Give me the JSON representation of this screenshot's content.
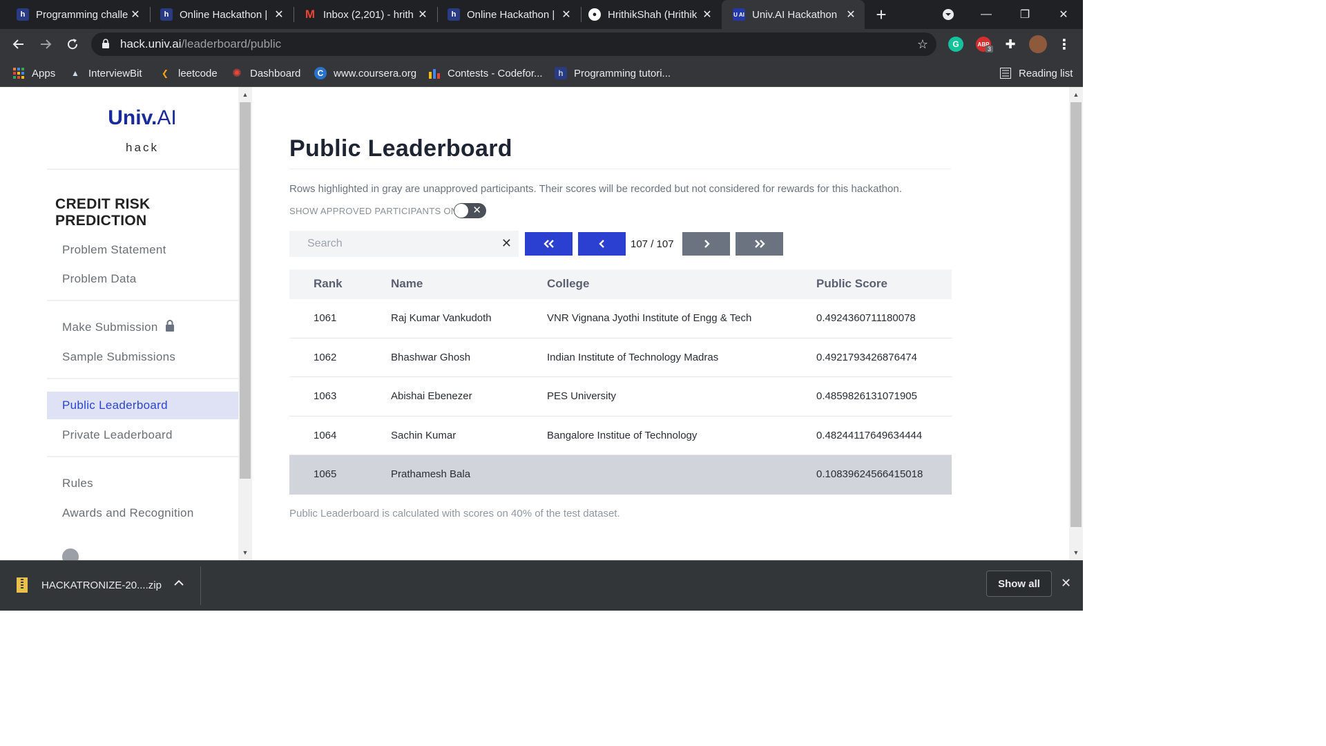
{
  "browser": {
    "tabs": [
      {
        "title": "Programming challe",
        "favicon": "h"
      },
      {
        "title": "Online Hackathon |",
        "favicon": "h"
      },
      {
        "title": "Inbox (2,201) - hrith",
        "favicon": "M"
      },
      {
        "title": "Online Hackathon |",
        "favicon": "h"
      },
      {
        "title": "HrithikShah (Hrithik",
        "favicon": "github"
      },
      {
        "title": "Univ.AI Hackathon",
        "favicon": "AI",
        "active": true
      }
    ],
    "url_host": "hack.univ.ai",
    "url_path": "/leaderboard/public",
    "extension_badge": "3",
    "bookmarks": [
      {
        "label": "Apps"
      },
      {
        "label": "InterviewBit"
      },
      {
        "label": "leetcode"
      },
      {
        "label": "Dashboard"
      },
      {
        "label": "www.coursera.org"
      },
      {
        "label": "Contests - Codefor..."
      },
      {
        "label": "Programming tutori..."
      }
    ],
    "reading_list": "Reading list"
  },
  "sidebar": {
    "brand": {
      "univ": "Univ.",
      "ai": "AI",
      "sub": "hack"
    },
    "competition_title": "CREDIT RISK PREDICTION",
    "items": [
      {
        "label": "Problem Statement"
      },
      {
        "label": "Problem Data"
      },
      {
        "label": "Make Submission",
        "locked": true
      },
      {
        "label": "Sample Submissions"
      },
      {
        "label": "Public Leaderboard",
        "active": true
      },
      {
        "label": "Private Leaderboard"
      },
      {
        "label": "Rules"
      },
      {
        "label": "Awards and Recognition"
      }
    ]
  },
  "main": {
    "title": "Public Leaderboard",
    "note": "Rows highlighted in gray are unapproved participants. Their scores will be recorded but not considered for rewards for this hackathon.",
    "toggle_label": "SHOW APPROVED PARTICIPANTS ONLY",
    "search_placeholder": "Search",
    "page_indicator": "107 / 107",
    "columns": {
      "rank": "Rank",
      "name": "Name",
      "college": "College",
      "score": "Public Score"
    },
    "rows": [
      {
        "rank": "1061",
        "name": "Raj Kumar Vankudoth",
        "college": "VNR Vignana Jyothi Institute of Engg & Tech",
        "score": "0.4924360711180078",
        "approved": true
      },
      {
        "rank": "1062",
        "name": "Bhashwar Ghosh",
        "college": "Indian Institute of Technology Madras",
        "score": "0.4921793426876474",
        "approved": true
      },
      {
        "rank": "1063",
        "name": "Abishai Ebenezer",
        "college": "PES University",
        "score": "0.4859826131071905",
        "approved": true
      },
      {
        "rank": "1064",
        "name": "Sachin Kumar",
        "college": "Bangalore Institue of Technology",
        "score": "0.48244117649634444",
        "approved": true
      },
      {
        "rank": "1065",
        "name": "Prathamesh Bala",
        "college": "",
        "score": "0.10839624566415018",
        "approved": false
      }
    ],
    "footer_note": "Public Leaderboard is calculated with scores on 40% of the test dataset."
  },
  "downloads": {
    "file": "HACKATRONIZE-20....zip",
    "show_all": "Show all"
  },
  "colors": {
    "accent": "#2b3fd0",
    "brand": "#1a2a9a",
    "active_nav_bg": "#dfe1f5",
    "unapproved_row": "#d1d5db"
  }
}
